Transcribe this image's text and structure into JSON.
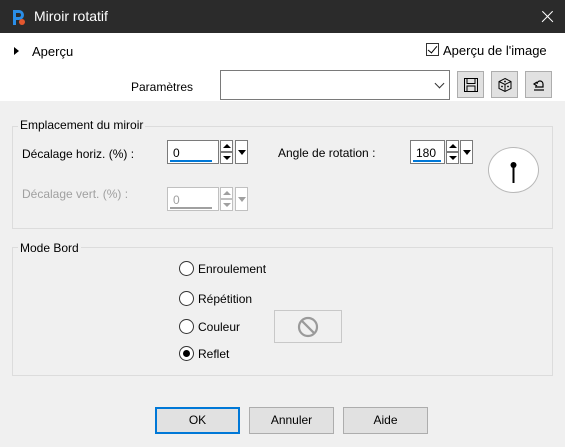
{
  "window": {
    "title": "Miroir rotatif",
    "icon": "app-logo-icon"
  },
  "top": {
    "apercu_label": "Aperçu",
    "preview_checkbox_label": "Aperçu de l'image",
    "preview_checked": true,
    "params_label": "Paramètres",
    "params_value": "",
    "toolbar_icons": [
      "save-icon",
      "random-dice-icon",
      "reset-icon"
    ]
  },
  "mirror_group": {
    "title": "Emplacement du miroir",
    "horiz_label": "Décalage horiz. (%) :",
    "horiz_value": "0",
    "vert_label": "Décalage vert. (%) :",
    "vert_value": "0",
    "angle_label": "Angle de rotation :",
    "angle_value": "180"
  },
  "edge_group": {
    "title": "Mode Bord",
    "options": [
      {
        "label": "Enroulement",
        "checked": false
      },
      {
        "label": "Répétition",
        "checked": false
      },
      {
        "label": "Couleur",
        "checked": false
      },
      {
        "label": "Reflet",
        "checked": true
      }
    ]
  },
  "buttons": {
    "ok": "OK",
    "cancel": "Annuler",
    "help": "Aide"
  },
  "colors": {
    "titlebar": "#2b2b2b",
    "accent": "#0078d7",
    "background": "#f0f0f0"
  }
}
